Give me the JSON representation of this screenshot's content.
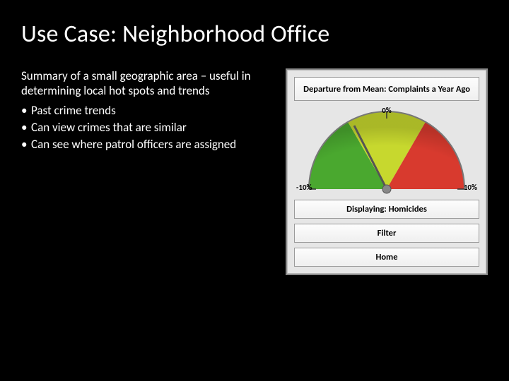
{
  "title": "Use Case: Neighborhood Office",
  "summary": "Summary of a small geographic area – useful in determining local hot spots and trends",
  "bullets": [
    "Past crime trends",
    "Can view crimes that are similar",
    "Can see where patrol officers are assigned"
  ],
  "widget": {
    "header": "Departure from Mean: Complaints a Year Ago",
    "displaying": "Displaying: Homicides",
    "filter": "Filter",
    "home": "Home"
  },
  "chart_data": {
    "type": "gauge",
    "title": "Departure from Mean: Complaints a Year Ago",
    "min": -10,
    "max": 10,
    "min_label": "-10%",
    "max_label": "10%",
    "mid_label": "0%",
    "value": -3,
    "zones": [
      {
        "color": "#4aa82f",
        "from": -10,
        "to": -3
      },
      {
        "color": "#c7d82e",
        "from": -3,
        "to": 3
      },
      {
        "color": "#d83a2e",
        "from": 3,
        "to": 10
      }
    ]
  }
}
